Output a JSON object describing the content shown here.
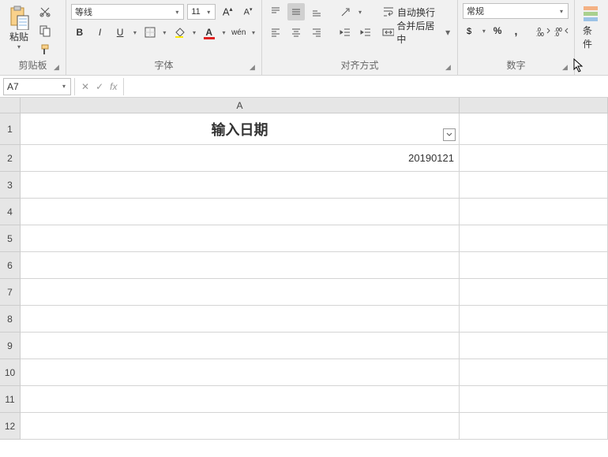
{
  "ribbon": {
    "clipboard": {
      "paste": "粘贴",
      "label": "剪贴板"
    },
    "font": {
      "name": "等线",
      "size": "11",
      "bold": "B",
      "italic": "I",
      "underline": "U",
      "wen": "wén",
      "label": "字体"
    },
    "align": {
      "wrap": "自动换行",
      "merge": "合并后居中",
      "label": "对齐方式"
    },
    "number": {
      "format": "常规",
      "label": "数字"
    },
    "cond": "条件"
  },
  "formula_bar": {
    "name_box": "A7",
    "fx": "fx",
    "formula": ""
  },
  "grid": {
    "col_headers": [
      "A"
    ],
    "row_headers": [
      "1",
      "2",
      "3",
      "4",
      "5",
      "6",
      "7",
      "8",
      "9",
      "10",
      "11",
      "12"
    ],
    "cells": {
      "A1": "输入日期",
      "A2": "20190121"
    },
    "colA_width": 556
  }
}
